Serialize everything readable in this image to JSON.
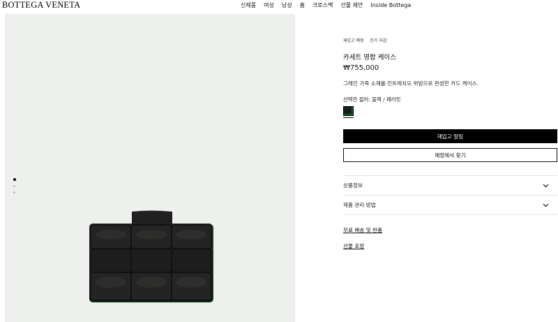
{
  "header": {
    "logo": "BOTTEGA VENETA",
    "nav": [
      "신제품",
      "여성",
      "남성",
      "홈",
      "크로스백",
      "선물 제안",
      "Inside Bottega"
    ]
  },
  "gallery": {
    "image_label": "",
    "dot_count": 3,
    "active_dot": 0
  },
  "product": {
    "tags": [
      "재입고 예정",
      "인기 지갑"
    ],
    "title": "카세트 명함 케이스",
    "price": "₩755,000",
    "description": "그레인 가죽 소재를 인트레치오 위빙으로 완성한 카드 케이스.",
    "color_label": "선택한 컬러: 블랙 / 패러킷",
    "swatch_colors": {
      "primary": "#1b1d1b",
      "accent": "#0c5a2a"
    }
  },
  "actions": {
    "notify": "재입고 알림",
    "find_store": "매장에서 찾기"
  },
  "accordion": [
    {
      "label": "상품정보"
    },
    {
      "label": "제품 관리 방법"
    }
  ],
  "links": {
    "shipping": "무료 배송 및 반품",
    "gift_wrap": "선물 포장"
  },
  "colors": {
    "primary_button": "#000000",
    "gallery_bg": "#eef0ee"
  }
}
